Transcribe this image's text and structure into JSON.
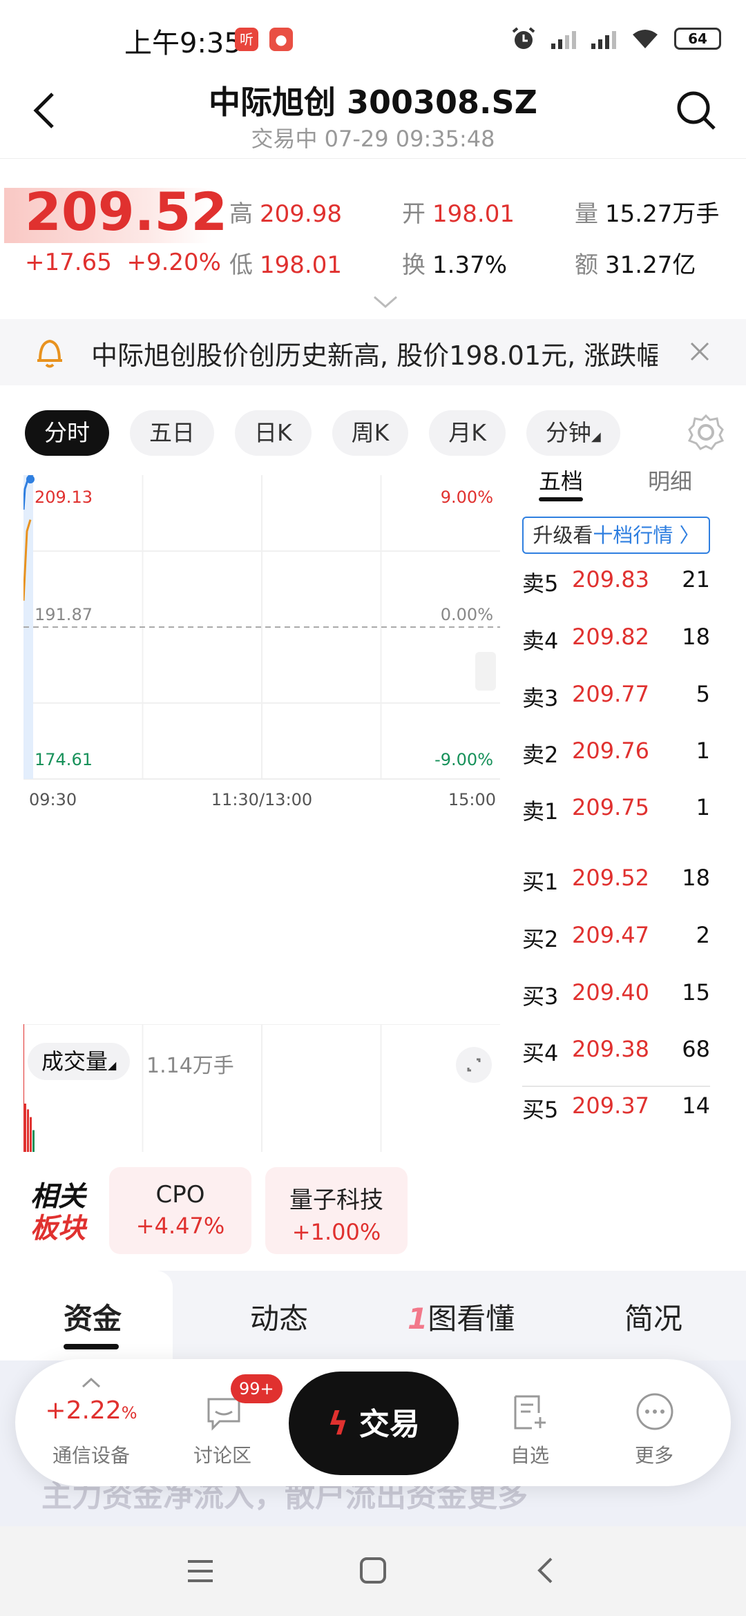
{
  "status_bar": {
    "time": "上午9:35",
    "badge1": "听",
    "battery": "64"
  },
  "header": {
    "title": "中际旭创 300308.SZ",
    "subtitle": "交易中 07-29 09:35:48"
  },
  "quote": {
    "price": "209.52",
    "change": "+17.65",
    "change_pct": "+9.20%",
    "items": [
      {
        "k": "高",
        "v": "209.98",
        "color": "red"
      },
      {
        "k": "开",
        "v": "198.01",
        "color": "red"
      },
      {
        "k": "量",
        "v": "15.27万手",
        "color": "dark"
      },
      {
        "k": "低",
        "v": "198.01",
        "color": "red"
      },
      {
        "k": "换",
        "v": "1.37%",
        "color": "dark"
      },
      {
        "k": "额",
        "v": "31.27亿",
        "color": "dark"
      }
    ]
  },
  "notice": {
    "text": "中际旭创股价创历史新高, 股价198.01元, 涨跌幅"
  },
  "period_tabs": [
    "分时",
    "五日",
    "日K",
    "周K",
    "月K",
    "分钟"
  ],
  "chart_data": {
    "type": "line",
    "title": "",
    "y_labels_left": [
      "209.13",
      "191.87",
      "174.61"
    ],
    "y_labels_right": [
      "9.00%",
      "0.00%",
      "-9.00%"
    ],
    "x_labels": [
      "09:30",
      "11:30/13:00",
      "15:00"
    ],
    "prev_close": 191.87,
    "ylim": [
      174.61,
      209.13
    ],
    "price_series": [
      209.13,
      209.98,
      209.52
    ],
    "avg_series": [
      198.01,
      205.9,
      207.2
    ],
    "volume_label": "成交量",
    "volume_value": "1.14万手",
    "volume_bars": [
      1.0,
      0.88,
      0.72,
      0.45
    ]
  },
  "depth": {
    "tabs": [
      "五档",
      "明细"
    ],
    "upgrade_prefix": "升级看",
    "upgrade_link": "十档行情",
    "sell": [
      {
        "label": "卖5",
        "price": "209.83",
        "qty": "21"
      },
      {
        "label": "卖4",
        "price": "209.82",
        "qty": "18"
      },
      {
        "label": "卖3",
        "price": "209.77",
        "qty": "5"
      },
      {
        "label": "卖2",
        "price": "209.76",
        "qty": "1"
      },
      {
        "label": "卖1",
        "price": "209.75",
        "qty": "1"
      }
    ],
    "buy": [
      {
        "label": "买1",
        "price": "209.52",
        "qty": "18"
      },
      {
        "label": "买2",
        "price": "209.47",
        "qty": "2"
      },
      {
        "label": "买3",
        "price": "209.40",
        "qty": "15"
      },
      {
        "label": "买4",
        "price": "209.38",
        "qty": "68"
      },
      {
        "label": "买5",
        "price": "209.37",
        "qty": "14"
      }
    ]
  },
  "related": {
    "title_line1": "相关",
    "title_line2": "板块",
    "cards": [
      {
        "name": "CPO",
        "pct": "+4.47%"
      },
      {
        "name": "量子科技",
        "pct": "+1.00%"
      }
    ]
  },
  "bottom_tabs": [
    "资金",
    "动态",
    "图看懂",
    "简况"
  ],
  "bottom_tab_mark": "1",
  "hidden_text": "主力资金净流入，散户流出资金更多",
  "action_bar": {
    "sector_pct": "+2.22",
    "sector_pct_unit": "%",
    "sector_name": "通信设备",
    "discuss_badge": "99+",
    "discuss_label": "讨论区",
    "trade_label": "交易",
    "watch_label": "自选",
    "more_label": "更多"
  },
  "colors": {
    "up": "#e0312f",
    "down": "#17915a",
    "accent_blue": "#2f7fe0",
    "avg_line": "#e8921f",
    "price_line": "#2f7fe0"
  }
}
